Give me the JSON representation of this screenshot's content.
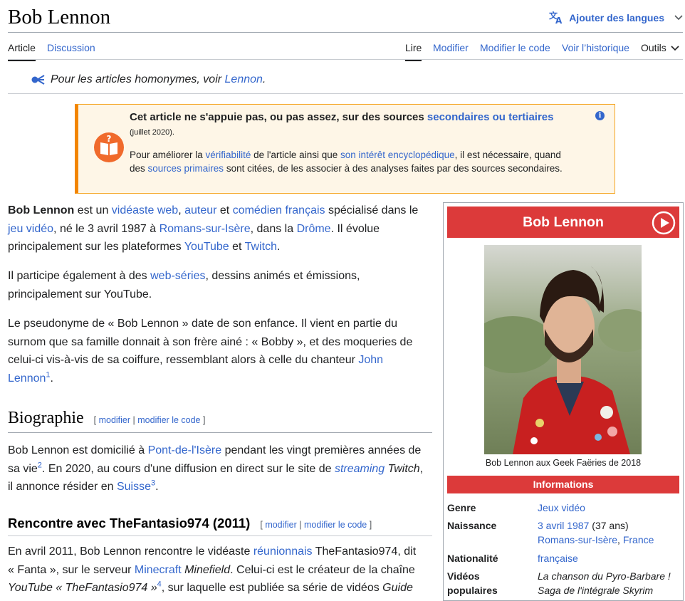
{
  "header": {
    "title": "Bob Lennon",
    "lang_button": "Ajouter des langues"
  },
  "tabs": {
    "article": "Article",
    "discussion": "Discussion",
    "read": "Lire",
    "edit": "Modifier",
    "edit_source": "Modifier le code",
    "history": "Voir l’historique",
    "tools": "Outils"
  },
  "hatnote": {
    "prefix": "Pour les articles homonymes, voir ",
    "link": "Lennon",
    "suffix": "."
  },
  "banner": {
    "head_prefix": "Cet article ne s'appuie pas, ou pas assez, sur des sources ",
    "head_link": "secondaires ou tertiaires",
    "date": "(juillet 2020).",
    "body_1": "Pour améliorer la ",
    "body_link_1": "vérifiabilité",
    "body_2": " de l'article ainsi que ",
    "body_link_2": "son intérêt encyclopédique",
    "body_3": ", il est nécessaire, quand des ",
    "body_link_3": "sources primaires",
    "body_4": " sont citées, de les associer à des analyses faites par des sources secondaires.",
    "info_glyph": "i"
  },
  "intro": {
    "p1_bold": "Bob Lennon",
    "p1_a": " est un ",
    "p1_l1": "vidéaste web",
    "p1_b": ", ",
    "p1_l2": "auteur",
    "p1_c": " et ",
    "p1_l3": "comédien français",
    "p1_d": " spécialisé dans le ",
    "p1_l4": "jeu vidéo",
    "p1_e": ", né le 3 avril 1987 à ",
    "p1_l5": "Romans-sur-Isère",
    "p1_f": ", dans la ",
    "p1_l6": "Drôme",
    "p1_g": ". Il évolue principalement sur les plateformes ",
    "p1_l7": "YouTube",
    "p1_h": " et ",
    "p1_l8": "Twitch",
    "p1_i": ".",
    "p2_a": "Il participe également à des ",
    "p2_l1": "web-séries",
    "p2_b": ", dessins animés et émissions, principalement sur YouTube.",
    "p3_a": "Le pseudonyme de « Bob Lennon » date de son enfance. Il vient en partie du surnom que sa famille donnait à son frère ainé : « Bobby », et des moqueries de celui-ci vis-à-vis de sa coiffure, ressemblant alors à celle du chanteur ",
    "p3_l1": "John Lennon",
    "p3_ref": "1",
    "p3_b": "."
  },
  "biographie": {
    "title": "Biographie",
    "edit": "modifier",
    "edit_source": "modifier le code",
    "p_a": "Bob Lennon est domicilié à ",
    "p_l1": "Pont-de-l'Isère",
    "p_b": " pendant les vingt premières années de sa vie",
    "p_ref1": "2",
    "p_c": ". En 2020, au cours d'une diffusion en direct sur le site de ",
    "p_l2": "streaming",
    "p_d": " Twitch",
    "p_e": ", il annonce résider en ",
    "p_l3": "Suisse",
    "p_ref2": "3",
    "p_f": "."
  },
  "rencontre": {
    "title": "Rencontre avec TheFantasio974 (2011)",
    "edit": "modifier",
    "edit_source": "modifier le code",
    "p_a": "En avril 2011, Bob Lennon rencontre le vidéaste ",
    "p_l1": "réunionnais",
    "p_b": " TheFantasio974, dit « Fanta », sur le serveur ",
    "p_l2": "Minecraft",
    "p_c": " Minefield",
    "p_d": ". Celui-ci est le créateur de la chaîne ",
    "p_e": "YouTube « TheFantasio974 »",
    "p_ref": "4",
    "p_f": ", sur laquelle est publiée sa série de vidéos ",
    "p_g": "Guide"
  },
  "infobox": {
    "title": "Bob Lennon",
    "caption": "Bob Lennon aux Geek Faëries de 2018",
    "section": "Informations",
    "rows": [
      {
        "label": "Genre",
        "value": "Jeux vidéo"
      },
      {
        "label": "Naissance",
        "value_link": "3 avril 1987",
        "value_extra": " (37 ans)",
        "value_line2_l1": "Romans-sur-Isère",
        "value_line2_sep": ", ",
        "value_line2_l2": "France"
      },
      {
        "label": "Nationalité",
        "value": "française"
      },
      {
        "label": "Vidéos populaires",
        "value_1": "La chanson du Pyro-Barbare !",
        "value_2": "Saga de l'intégrale Skyrim"
      }
    ]
  },
  "colors": {
    "link": "#3366cc",
    "infobox_header": "#dc3a3a",
    "banner_bg": "#fef6e7",
    "banner_accent": "#f28500"
  },
  "icons": [
    "translate-icon",
    "chevron-down-icon",
    "disambiguation-icon",
    "book-question-icon",
    "info-icon",
    "play-icon"
  ]
}
